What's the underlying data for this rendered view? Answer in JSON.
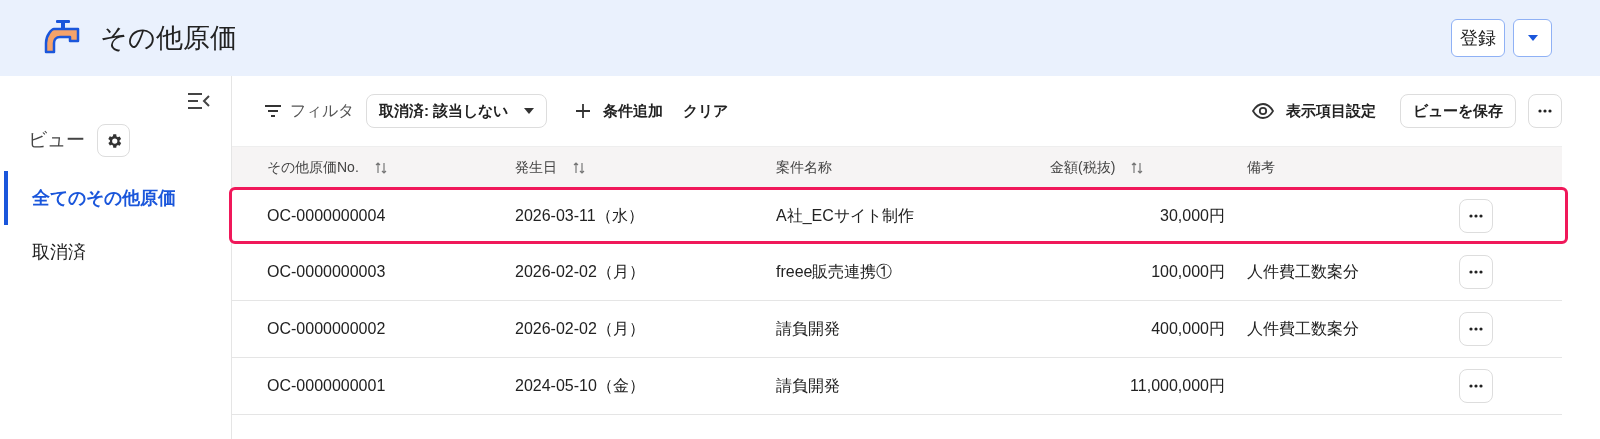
{
  "header": {
    "title": "その他原価",
    "buttons": [
      {
        "label": "登録"
      }
    ]
  },
  "sidebar": {
    "section_label": "ビュー",
    "items": [
      {
        "label": "全てのその他原価",
        "selected": true
      },
      {
        "label": "取消済",
        "selected": false
      }
    ]
  },
  "toolbar": {
    "filter_label": "フィルタ",
    "filter_chip": "取消済: 該当しない",
    "add_condition": "条件追加",
    "clear": "クリア",
    "display_settings": "表示項目設定",
    "save_view": "ビューを保存"
  },
  "table": {
    "columns": [
      {
        "label": "その他原価No.",
        "sortable": true
      },
      {
        "label": "発生日",
        "sortable": true
      },
      {
        "label": "案件名称",
        "sortable": false
      },
      {
        "label": "金額(税抜)",
        "sortable": true
      },
      {
        "label": "備考",
        "sortable": false
      }
    ],
    "rows": [
      {
        "number": "OC-0000000004",
        "date": "2026-03-11（水）",
        "project": "A社_ECサイト制作",
        "amount": "30,000円",
        "note": "",
        "highlighted": true
      },
      {
        "number": "OC-0000000003",
        "date": "2026-02-02（月）",
        "project": "freee販売連携①",
        "amount": "100,000円",
        "note": "人件費工数案分",
        "highlighted": false
      },
      {
        "number": "OC-0000000002",
        "date": "2026-02-02（月）",
        "project": "請負開発",
        "amount": "400,000円",
        "note": "人件費工数案分",
        "highlighted": false
      },
      {
        "number": "OC-0000000001",
        "date": "2024-05-10（金）",
        "project": "請負開発",
        "amount": "11,000,000円",
        "note": "",
        "highlighted": false
      }
    ]
  }
}
